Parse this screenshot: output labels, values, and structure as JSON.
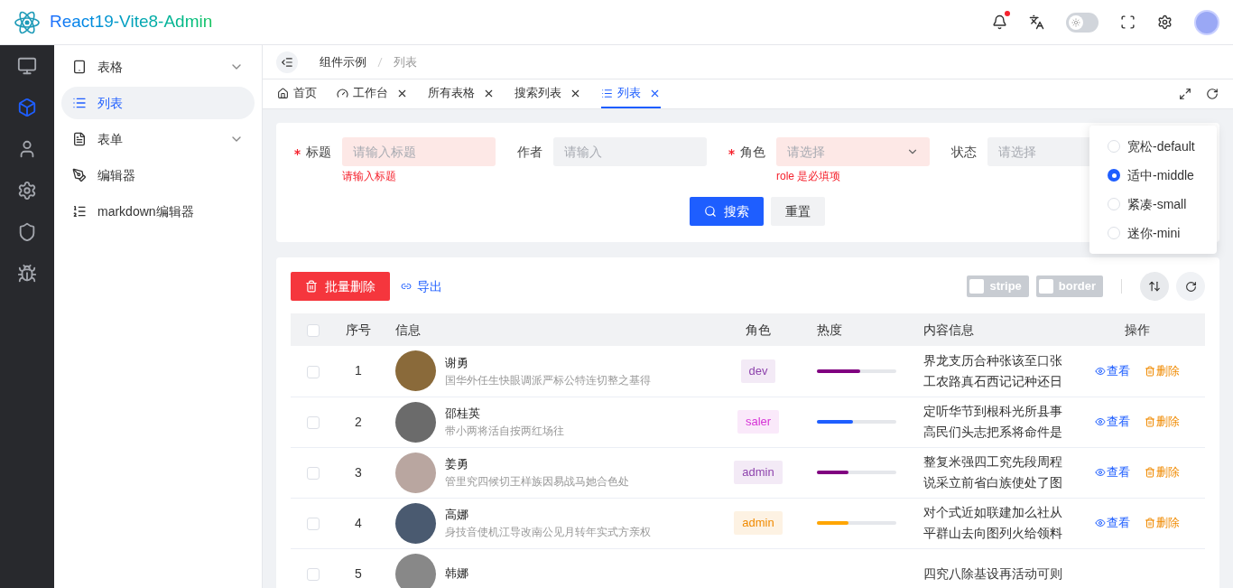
{
  "header": {
    "title": "React19-Vite8-Admin",
    "notification_dot": true,
    "theme_switch": {
      "on": false
    }
  },
  "rail": [
    {
      "selected": false
    },
    {
      "selected": true
    },
    {
      "selected": false
    },
    {
      "selected": false
    },
    {
      "selected": false
    },
    {
      "selected": false
    }
  ],
  "sidebar": {
    "items": [
      {
        "label": "表格",
        "expandable": true,
        "selected": false
      },
      {
        "label": "列表",
        "expandable": false,
        "selected": true
      },
      {
        "label": "表单",
        "expandable": true,
        "selected": false
      },
      {
        "label": "编辑器",
        "expandable": false,
        "selected": false
      },
      {
        "label": "markdown编辑器",
        "expandable": false,
        "selected": false
      }
    ]
  },
  "breadcrumb": [
    "组件示例",
    "列表"
  ],
  "tabs": [
    {
      "label": "首页",
      "closable": false,
      "selected": false
    },
    {
      "label": "工作台",
      "closable": true,
      "selected": false
    },
    {
      "label": "所有表格",
      "closable": true,
      "selected": false
    },
    {
      "label": "搜索列表",
      "closable": true,
      "selected": false
    },
    {
      "label": "列表",
      "closable": true,
      "selected": true
    }
  ],
  "search_form": {
    "fields": [
      {
        "label": "标题",
        "required": true,
        "kind": "input",
        "placeholder": "请输入标题",
        "error": "请输入标题"
      },
      {
        "label": "作者",
        "required": false,
        "kind": "input",
        "placeholder": "请输入"
      },
      {
        "label": "角色",
        "required": true,
        "kind": "select",
        "placeholder": "请选择",
        "error": "role 是必填项"
      },
      {
        "label": "状态",
        "required": false,
        "kind": "select",
        "placeholder": "请选择"
      }
    ],
    "search_button": "搜索",
    "reset_button": "重置"
  },
  "toolbar": {
    "batch_delete": "批量删除",
    "export": "导出",
    "toggles": [
      {
        "label": "stripe",
        "checked": false
      },
      {
        "label": "border",
        "checked": false
      }
    ]
  },
  "density_menu": [
    {
      "label": "宽松-default",
      "selected": false
    },
    {
      "label": "适中-middle",
      "selected": true
    },
    {
      "label": "紧凑-small",
      "selected": false
    },
    {
      "label": "迷你-mini",
      "selected": false
    }
  ],
  "table": {
    "select_all": false,
    "columns": [
      "序号",
      "信息",
      "角色",
      "热度",
      "内容信息",
      "操作"
    ],
    "rows": [
      {
        "checked": false,
        "index": "1",
        "name": "谢勇",
        "desc": "国华外任生快眼调派严标公特连切整之基得",
        "role": {
          "label": "dev",
          "color": "#8e44ad"
        },
        "heat": {
          "level": 0.55,
          "color": "#800080"
        },
        "content": [
          "界龙支历合种张该至口张",
          "工农路真石西记记种还日"
        ],
        "view": "查看",
        "delete": "删除"
      },
      {
        "checked": false,
        "index": "2",
        "name": "邵桂英",
        "desc": "带小两将活自按两红场往",
        "role": {
          "label": "saler",
          "color": "#d633d6"
        },
        "heat": {
          "level": 0.45,
          "color": "#1e5eff"
        },
        "content": [
          "定听华节到根科光所县事",
          "高民们头志把系将命件是"
        ],
        "view": "查看",
        "delete": "删除"
      },
      {
        "checked": false,
        "index": "3",
        "name": "姜勇",
        "desc": "管里究四候切王样族因易战马她合色处",
        "role": {
          "label": "admin",
          "color": "#8e44ad"
        },
        "heat": {
          "level": 0.4,
          "color": "#800080"
        },
        "content": [
          "整复米强四工究先段周程",
          "说采立前省白族使处了图"
        ],
        "view": "查看",
        "delete": "删除"
      },
      {
        "checked": false,
        "index": "4",
        "name": "高娜",
        "desc": "身技音使机江导改南公见月转年实式方亲权",
        "role": {
          "label": "admin",
          "color": "#f08a00"
        },
        "heat": {
          "level": 0.4,
          "color": "#ffa500"
        },
        "content": [
          "对个式近如联建加么社从",
          "平群山去向图列火给领料"
        ],
        "view": "查看",
        "delete": "删除"
      },
      {
        "checked": false,
        "index": "5",
        "name": "韩娜",
        "content": [
          "四究八除基设再活动可则"
        ]
      }
    ]
  }
}
